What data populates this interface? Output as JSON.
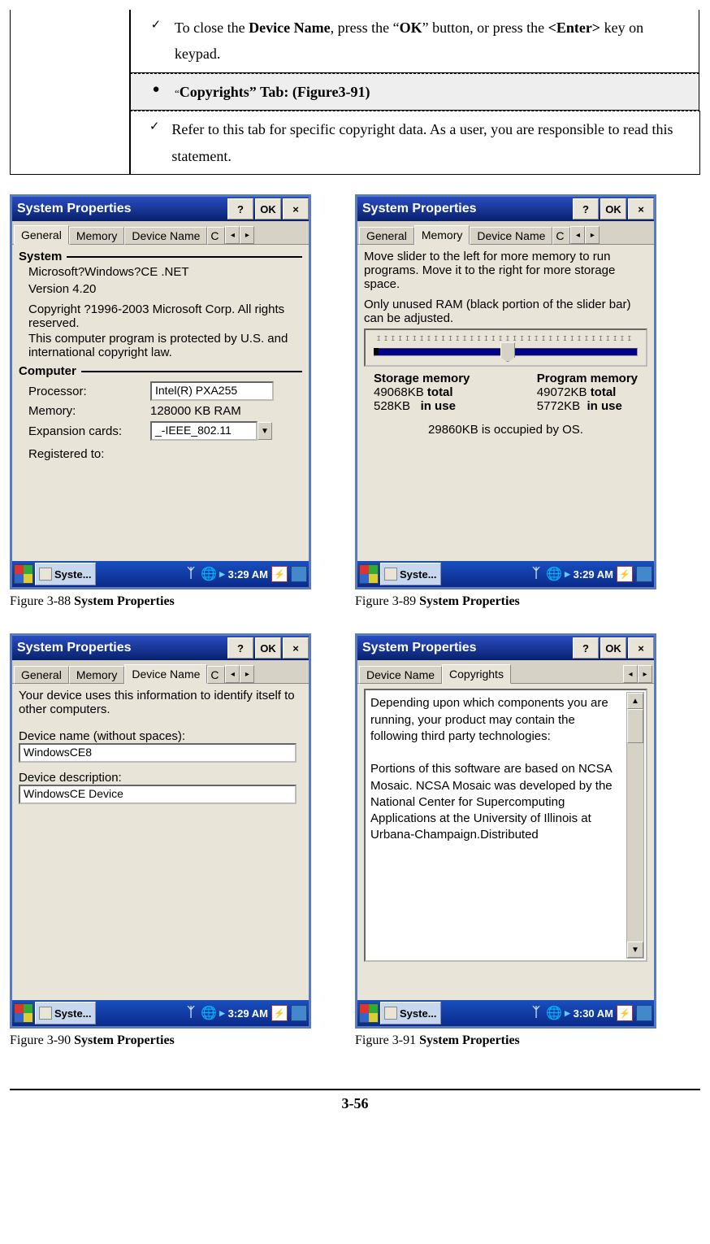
{
  "instructions": {
    "row1": {
      "bullet": "✓",
      "text_a": "To close the ",
      "bold_a": "Device Name",
      "text_b": ", press the “",
      "bold_b": "OK",
      "text_c": "” button, or press the ",
      "bold_c": "<Enter>",
      "text_d": " key on keypad."
    },
    "row2": {
      "bullet": "●",
      "quote": "“",
      "bold": "Copyrights” Tab: (Figure3-91)"
    },
    "row3": {
      "bullet": "✓",
      "text": "Refer to this tab for specific copyright data. As a user, you are responsible to read this statement."
    }
  },
  "titlebar": {
    "title": "System Properties",
    "help": "?",
    "ok": "OK",
    "close": "×"
  },
  "tabs": {
    "general": "General",
    "memory": "Memory",
    "device_name": "Device Name",
    "copyrights": "Copyrights",
    "scroll_partial_c": "C",
    "scroll_left": "◂",
    "scroll_right": "▸"
  },
  "fig88": {
    "system_label": "System",
    "line1": "Microsoft?Windows?CE .NET",
    "line2": "Version 4.20",
    "line3": "Copyright ?1996-2003 Microsoft Corp. All rights reserved.",
    "line4": "This computer program is protected by U.S. and international copyright law.",
    "computer_label": "Computer",
    "proc_lbl": "Processor:",
    "proc_val": "Intel(R) PXA255",
    "mem_lbl": "Memory:",
    "mem_val": "128000 KB  RAM",
    "exp_lbl": "Expansion cards:",
    "exp_val": "_-IEEE_802.11",
    "reg_lbl": "Registered to:"
  },
  "fig89": {
    "desc1": "Move slider to the left for more memory to run programs. Move it to the right for more storage space.",
    "desc2": "Only unused RAM (black portion of the slider bar) can be adjusted.",
    "storage_header": "Storage memory",
    "program_header": "Program memory",
    "s_total": "49068KB",
    "s_total_lbl": "total",
    "s_use": "528KB",
    "s_use_lbl": "in use",
    "p_total": "49072KB",
    "p_total_lbl": "total",
    "p_use": "5772KB",
    "p_use_lbl": "in use",
    "os_line": "29860KB  is occupied by OS."
  },
  "fig90": {
    "desc": "Your device uses this information to identify itself to other computers.",
    "name_lbl": "Device name (without spaces):",
    "name_val": "WindowsCE8",
    "descr_lbl": "Device description:",
    "descr_val": "WindowsCE Device"
  },
  "fig91": {
    "text": "Depending upon which components you are running, your product may contain the following third party technologies:\n\nPortions of this software are based on NCSA Mosaic. NCSA Mosaic was developed by the National Center for Supercomputing Applications at the University of Illinois at Urbana-Champaign.Distributed"
  },
  "taskbar": {
    "btn_label": "Syste...",
    "time_329": "3:29 AM",
    "time_330": "3:30 AM"
  },
  "captions": {
    "c88a": "Figure 3-88 ",
    "c88b": "System Properties",
    "c89a": "Figure 3-89 ",
    "c89b": "System Properties",
    "c90a": "Figure 3-90 ",
    "c90b": "System Properties",
    "c91a": "Figure 3-91 ",
    "c91b": "System Properties"
  },
  "page_number": "3-56"
}
